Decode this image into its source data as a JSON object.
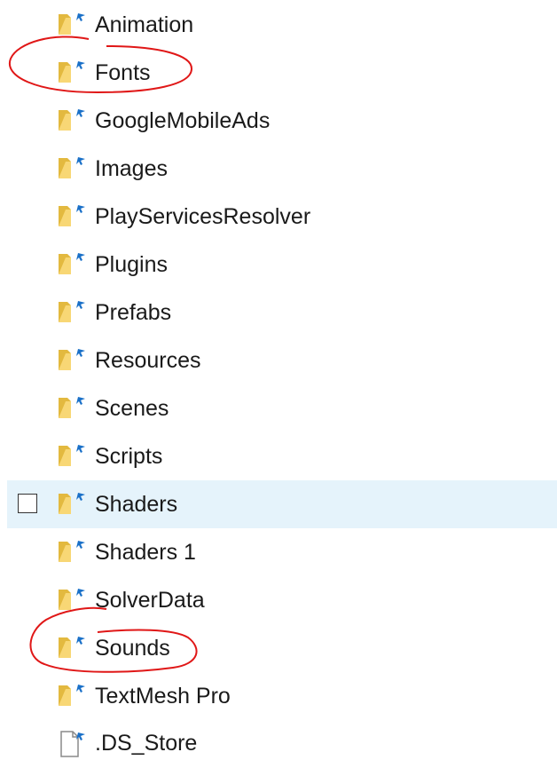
{
  "files": [
    {
      "name": "Animation",
      "type": "folder",
      "selected": false,
      "highlighted": false
    },
    {
      "name": "Fonts",
      "type": "folder",
      "selected": false,
      "highlighted": true
    },
    {
      "name": "GoogleMobileAds",
      "type": "folder",
      "selected": false,
      "highlighted": false
    },
    {
      "name": "Images",
      "type": "folder",
      "selected": false,
      "highlighted": false
    },
    {
      "name": "PlayServicesResolver",
      "type": "folder",
      "selected": false,
      "highlighted": false
    },
    {
      "name": "Plugins",
      "type": "folder",
      "selected": false,
      "highlighted": false
    },
    {
      "name": "Prefabs",
      "type": "folder",
      "selected": false,
      "highlighted": false
    },
    {
      "name": "Resources",
      "type": "folder",
      "selected": false,
      "highlighted": false
    },
    {
      "name": "Scenes",
      "type": "folder",
      "selected": false,
      "highlighted": false
    },
    {
      "name": "Scripts",
      "type": "folder",
      "selected": false,
      "highlighted": false
    },
    {
      "name": "Shaders",
      "type": "folder",
      "selected": true,
      "highlighted": false
    },
    {
      "name": "Shaders 1",
      "type": "folder",
      "selected": false,
      "highlighted": false
    },
    {
      "name": "SolverData",
      "type": "folder",
      "selected": false,
      "highlighted": false
    },
    {
      "name": "Sounds",
      "type": "folder",
      "selected": false,
      "highlighted": true
    },
    {
      "name": "TextMesh Pro",
      "type": "folder",
      "selected": false,
      "highlighted": false
    },
    {
      "name": ".DS_Store",
      "type": "file",
      "selected": false,
      "highlighted": false
    }
  ],
  "colors": {
    "hover_row": "#e5f3fb",
    "folder_back": "#e3b93f",
    "folder_front": "#f8d775",
    "shortcut_arrow": "#1a70c8",
    "annotation_ink": "#e01717"
  },
  "icons": {
    "folder": "folder-icon",
    "file": "file-icon",
    "checkbox": "checkbox-icon"
  }
}
